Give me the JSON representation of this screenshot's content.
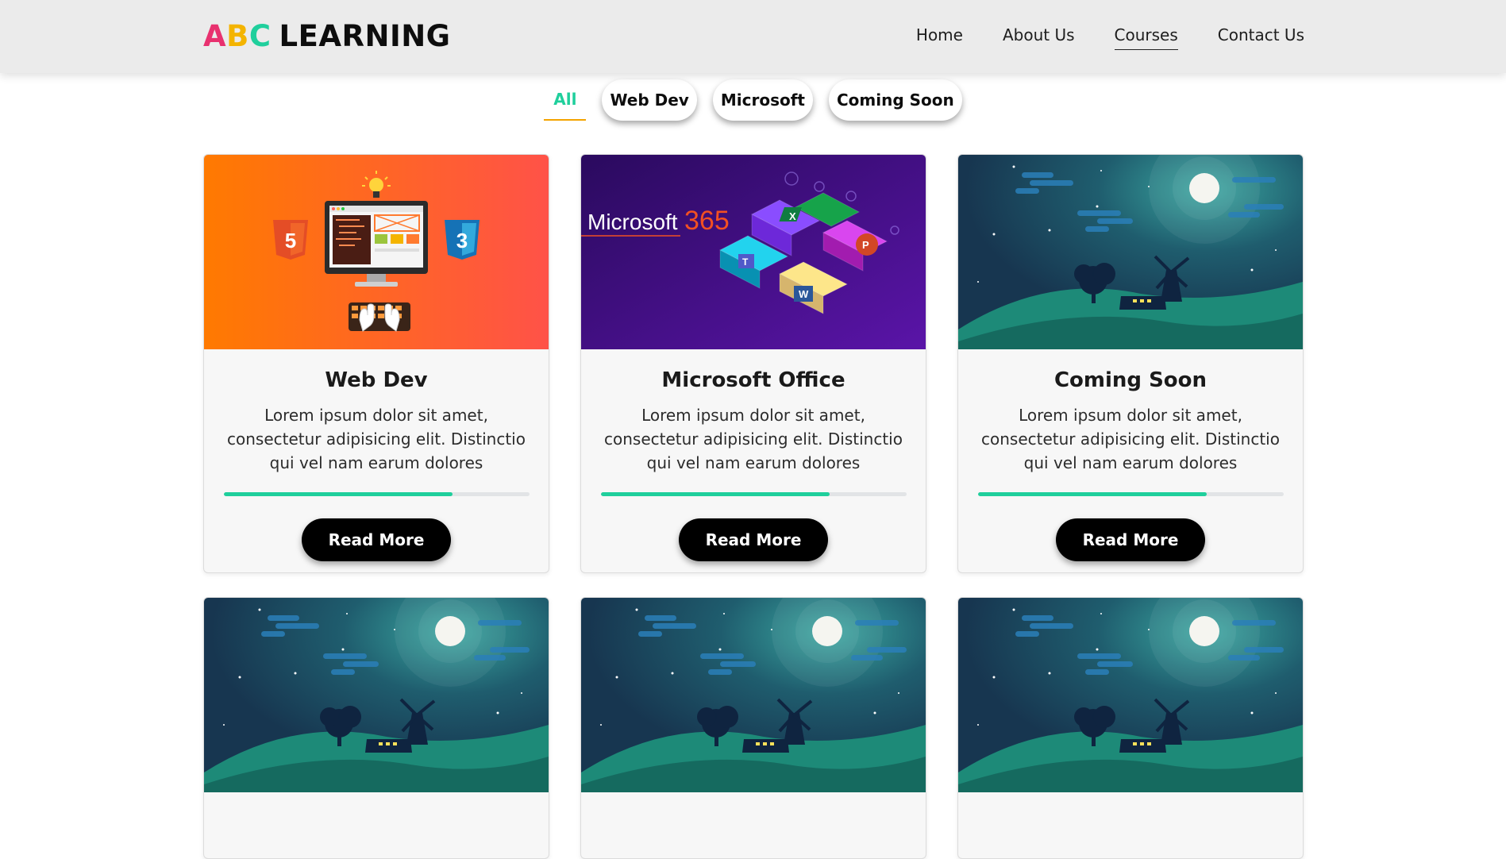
{
  "brand": {
    "letter_a": "A",
    "letter_b": "B",
    "letter_c": "C",
    "rest": "LEARNING",
    "colors": {
      "a": "#e8316f",
      "b": "#f4b400",
      "c": "#1fcf9c"
    }
  },
  "nav": [
    {
      "label": "Home",
      "active": false
    },
    {
      "label": "About Us",
      "active": false
    },
    {
      "label": "Courses",
      "active": true
    },
    {
      "label": "Contact Us",
      "active": false
    }
  ],
  "filters": [
    {
      "label": "All",
      "active": true
    },
    {
      "label": "Web Dev",
      "active": false
    },
    {
      "label": "Microsoft",
      "active": false
    },
    {
      "label": "Coming Soon",
      "active": false
    }
  ],
  "accent": "#1fcf9c",
  "cards": [
    {
      "title": "Web Dev",
      "image": "web-dev-illustration",
      "description": "Lorem ipsum dolor sit amet, consectetur adipisicing elit. Distinctio qui vel nam earum dolores",
      "progress": 0.75,
      "button": "Read More"
    },
    {
      "title": "Microsoft Office",
      "image": "microsoft-365-illustration",
      "image_text": {
        "brand": "Microsoft",
        "number": "365"
      },
      "description": "Lorem ipsum dolor sit amet, consectetur adipisicing elit. Distinctio qui vel nam earum dolores",
      "progress": 0.75,
      "button": "Read More"
    },
    {
      "title": "Coming Soon",
      "image": "night-windmill-illustration",
      "description": "Lorem ipsum dolor sit amet, consectetur adipisicing elit. Distinctio qui vel nam earum dolores",
      "progress": 0.75,
      "button": "Read More"
    },
    {
      "image": "night-windmill-illustration"
    },
    {
      "image": "night-windmill-illustration"
    },
    {
      "image": "night-windmill-illustration"
    }
  ]
}
